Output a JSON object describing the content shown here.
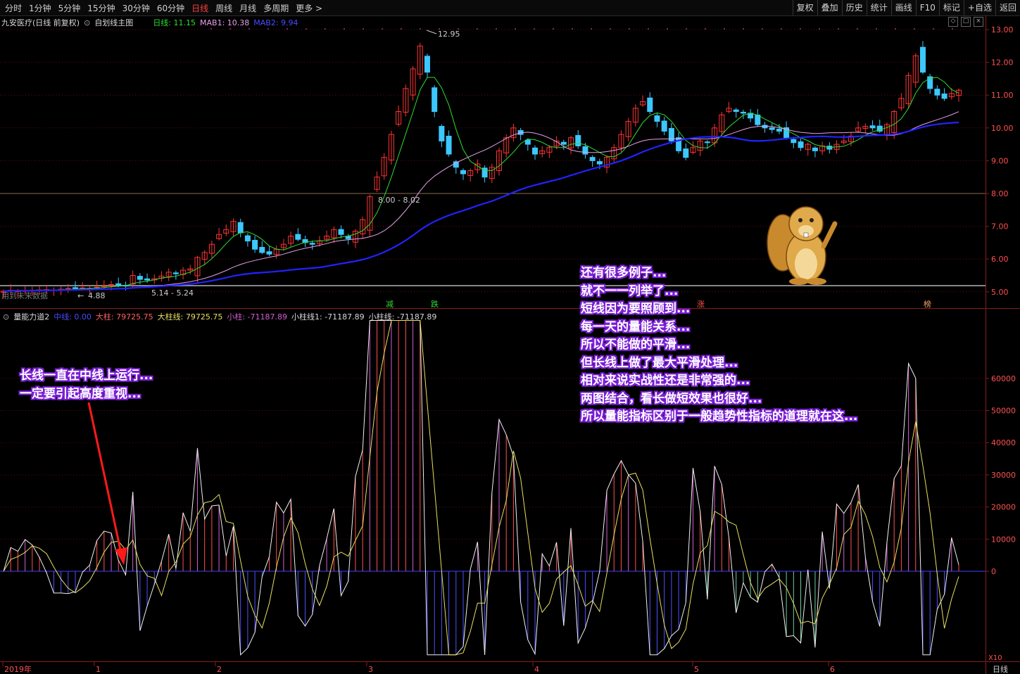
{
  "toolbar": {
    "periods": [
      "分时",
      "1分钟",
      "5分钟",
      "15分钟",
      "30分钟",
      "60分钟",
      "日线",
      "周线",
      "月线",
      "多周期",
      "更多 >"
    ],
    "active": "日线",
    "right_buttons": [
      "复权",
      "叠加",
      "历史",
      "统计",
      "画线",
      "F10",
      "标记",
      "+自选",
      "返回"
    ]
  },
  "main": {
    "stock": "九安医疗(日线 前复权)",
    "subtitle": "自划线主图",
    "ma_day": "日线: 11.15",
    "mab1": "MAB1: 10.38",
    "mab2": "MAB2: 9.94",
    "price_ticks": [
      "13.00",
      "12.00",
      "11.00",
      "10.00",
      "9.00",
      "8.00",
      "7.00",
      "6.00",
      "5.00"
    ],
    "hi_label": "12.95",
    "lo_label": "4.88",
    "range_label": "5.14 - 5.24",
    "gap_label": "8.00 - 8.02",
    "left_note": "用到未来数据",
    "markers": [
      "减",
      "跌",
      "涨",
      "榜"
    ]
  },
  "sub": {
    "name": "量能力道2",
    "mid_label": "中线: 0.00",
    "big_label": "大柱: 79725.75",
    "big_line": "大柱线: 79725.75",
    "small_label": "小柱: -71187.89",
    "small_line1": "小柱线1: -71187.89",
    "small_line2": "小柱线: -71187.89",
    "ticks": [
      "60000",
      "50000",
      "40000",
      "30000",
      "20000",
      "10000",
      "0"
    ],
    "multiplier": "X10"
  },
  "axis": {
    "dates": [
      "2019年",
      "1",
      "2",
      "3",
      "4",
      "5",
      "6"
    ],
    "period": "日线"
  },
  "annotations": {
    "left": [
      "长线一直在中线上运行...",
      "一定要引起高度重视..."
    ],
    "right": [
      "还有很多例子...",
      "就不一一列举了...",
      "短线因为要照顾到...",
      "每一天的量能关系...",
      "所以不能做的平滑...",
      "但长线上做了最大平滑处理...",
      "相对来说实战性还是非常强的...",
      "两图结合，看长做短效果也很好...",
      "所以量能指标区别于一般趋势性指标的道理就在这..."
    ]
  },
  "colors": {
    "up": "#ff3232",
    "down": "#3cc8ff",
    "ma_fast": "#2fdc2f",
    "mab1": "#e8a0e8",
    "mab2": "#2222ff",
    "bar_pos": "#ff5050",
    "bar_neg": "#5050ff",
    "ann_bg": "#7a1fd6"
  },
  "chart_data": {
    "type": "candlestick",
    "close": [
      5.02,
      5.05,
      5.03,
      5.04,
      5.05,
      5.06,
      5.07,
      5.06,
      5.08,
      5.1,
      5.1,
      5.12,
      5.11,
      5.14,
      5.18,
      5.22,
      5.2,
      5.18,
      5.5,
      5.38,
      5.36,
      5.4,
      5.48,
      5.6,
      5.55,
      5.66,
      5.7,
      6.05,
      6.2,
      6.45,
      6.75,
      6.9,
      7.15,
      6.8,
      6.55,
      6.3,
      6.2,
      6.15,
      6.3,
      6.45,
      6.7,
      6.6,
      6.5,
      6.45,
      6.55,
      6.7,
      6.9,
      6.75,
      6.62,
      6.85,
      7.2,
      7.9,
      8.5,
      9.1,
      9.8,
      10.5,
      11.2,
      11.8,
      12.5,
      11.7,
      10.5,
      9.6,
      9.2,
      8.8,
      8.6,
      8.7,
      8.9,
      8.5,
      8.8,
      9.3,
      9.7,
      10.0,
      9.8,
      9.5,
      9.2,
      9.3,
      9.4,
      9.6,
      9.5,
      9.7,
      9.45,
      9.2,
      9.0,
      8.9,
      9.1,
      9.4,
      9.8,
      10.2,
      10.6,
      10.8,
      10.5,
      10.2,
      9.9,
      9.6,
      9.3,
      9.1,
      9.4,
      9.6,
      9.55,
      10.0,
      10.4,
      10.6,
      10.5,
      10.45,
      10.3,
      10.1,
      10.0,
      9.95,
      9.9,
      9.7,
      9.55,
      9.4,
      9.5,
      9.3,
      9.45,
      9.35,
      9.5,
      9.6,
      9.75,
      10.0,
      10.05,
      10.0,
      9.9,
      10.1,
      10.5,
      10.9,
      11.6,
      12.2,
      11.7,
      11.2,
      11.0,
      10.9,
      11.05,
      11.15
    ]
  }
}
